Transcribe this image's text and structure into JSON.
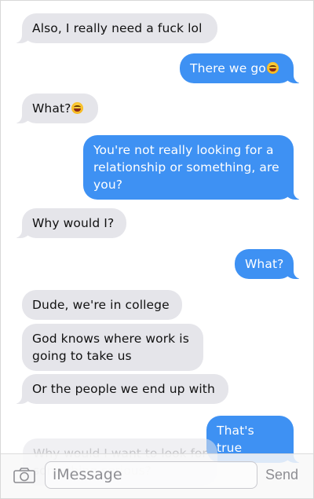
{
  "messages": [
    {
      "side": "in",
      "text": "Also, I really need a fuck lol",
      "emoji": false
    },
    {
      "side": "out",
      "text": "There we go",
      "emoji": true
    },
    {
      "side": "in",
      "text": "What?",
      "emoji": true
    },
    {
      "side": "out",
      "text": "You're not really looking for a relationship or something, are you?",
      "emoji": false
    },
    {
      "side": "in",
      "text": "Why would I?",
      "emoji": false
    },
    {
      "side": "out",
      "text": "What?",
      "emoji": false
    },
    {
      "side": "in",
      "text": "Dude, we're in college",
      "emoji": false
    },
    {
      "side": "in",
      "text": "God knows where work is going to take us",
      "emoji": false
    },
    {
      "side": "in",
      "text": "Or the people we end up with",
      "emoji": false
    },
    {
      "side": "out",
      "text": "That's true",
      "emoji": false
    }
  ],
  "partial_message": "Why would I want to look for something serious?",
  "composer": {
    "placeholder": "iMessage",
    "send_label": "Send"
  },
  "colors": {
    "incoming_bubble": "#e5e5ea",
    "outgoing_bubble": "#3e91f3",
    "send_inactive": "#8e8e93"
  },
  "icons": {
    "camera": "camera-icon",
    "emoji": "laughing-emoji-icon"
  }
}
